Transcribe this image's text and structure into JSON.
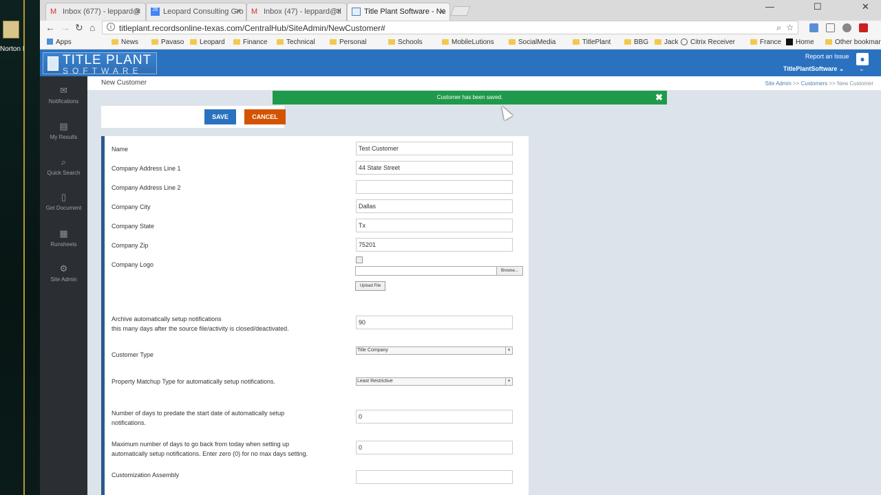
{
  "desktop": {
    "icon_label": "Norton Installati..."
  },
  "browser": {
    "tabs": [
      {
        "label": "Inbox (677) - leppard@",
        "icon": "gmail-icon",
        "active": false
      },
      {
        "label": "Leopard Consulting Gro",
        "icon": "calendar-icon",
        "active": false
      },
      {
        "label": "Inbox (47) - leppard@ti",
        "icon": "gmail-icon",
        "active": false
      },
      {
        "label": "Title Plant Software - Ne",
        "icon": "page-icon",
        "active": true
      }
    ],
    "url": "titleplant.recordsonline-texas.com/CentralHub/SiteAdmin/NewCustomer#",
    "bookmarks": [
      "Apps",
      "News",
      "Pavaso",
      "Leopard",
      "Finance",
      "Technical",
      "Personal",
      "Schools",
      "MobileLutions",
      "SocialMedia",
      "TitlePlant",
      "BBG",
      "Jack",
      "Citrix Receiver",
      "France",
      "Home"
    ],
    "other_bookmarks": "Other bookmarks"
  },
  "app": {
    "logo_line1": "TITLE PLANT",
    "logo_line2": "SOFTWARE",
    "report_issue": "Report an Issue",
    "user_menu": "TitlePlantSoftware",
    "sidebar": [
      {
        "label": "Notifications",
        "icon": "envelope-icon"
      },
      {
        "label": "My Results",
        "icon": "list-icon"
      },
      {
        "label": "Quick Search",
        "icon": "search-icon"
      },
      {
        "label": "Get Document",
        "icon": "document-icon"
      },
      {
        "label": "Runsheets",
        "icon": "table-icon"
      },
      {
        "label": "Site Admin",
        "icon": "gears-icon"
      }
    ],
    "page_title": "New Customer",
    "breadcrumb": {
      "items": [
        "Site Admin",
        "Customers",
        "New Customer"
      ],
      "separator": ">>"
    },
    "toast": "Customer has been saved.",
    "save_label": "SAVE",
    "cancel_label": "CANCEL",
    "form": {
      "name": {
        "label": "Name",
        "value": "Test Customer"
      },
      "address1": {
        "label": "Company Address Line 1",
        "value": "44 State Street"
      },
      "address2": {
        "label": "Company Address Line 2",
        "value": ""
      },
      "city": {
        "label": "Company City",
        "value": "Dallas"
      },
      "state": {
        "label": "Company State",
        "value": "Tx"
      },
      "zip": {
        "label": "Company Zip",
        "value": "75201"
      },
      "logo": {
        "label": "Company Logo",
        "browse": "Browse...",
        "upload": "Upload File"
      },
      "archive": {
        "label1": "Archive automatically setup notifications",
        "label2": "this many days after the source file/activity is closed/deactivated.",
        "value": "90"
      },
      "customer_type": {
        "label": "Customer Type",
        "value": "Title Company"
      },
      "matchup": {
        "label": "Property Matchup Type for automatically setup notifications.",
        "value": "Least Restrictive"
      },
      "predate": {
        "label1": "Number of days to predate the start date of automatically setup",
        "label2": "notifications.",
        "value": "0"
      },
      "maxdays": {
        "label1": "Maximum number of days to go back from today when setting up",
        "label2": "automatically setup notifications. Enter zero (0) for no max days setting.",
        "value": "0"
      },
      "assembly": {
        "label": "Customization Assembly",
        "value": ""
      }
    }
  }
}
